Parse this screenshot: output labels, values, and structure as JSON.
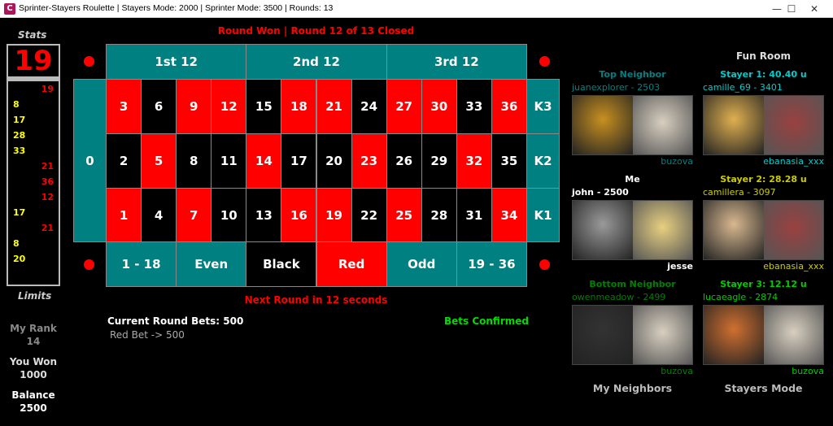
{
  "window": {
    "title": "Sprinter-Stayers Roulette | Stayers Mode: 2000 | Sprinter Mode: 3500 | Rounds: 13",
    "icon_letter": "C",
    "minimize": "—",
    "maximize": "☐",
    "close": "✕"
  },
  "status": {
    "round": "Round Won | Round 12 of 13 Closed",
    "next": "Next Round in 12 seconds",
    "confirmed": "Bets Confirmed"
  },
  "stats": {
    "label": "Stats",
    "last": "19",
    "history": [
      {
        "v": "19",
        "side": "r"
      },
      {
        "v": "8",
        "side": "l"
      },
      {
        "v": "17",
        "side": "l"
      },
      {
        "v": "28",
        "side": "l"
      },
      {
        "v": "33",
        "side": "l"
      },
      {
        "v": "21",
        "side": "r"
      },
      {
        "v": "36",
        "side": "r"
      },
      {
        "v": "12",
        "side": "r"
      },
      {
        "v": "17",
        "side": "l"
      },
      {
        "v": "21",
        "side": "r"
      },
      {
        "v": "8",
        "side": "l"
      },
      {
        "v": "20",
        "side": "l"
      }
    ],
    "limits": "Limits",
    "rank_label": "My Rank",
    "rank": "14",
    "won_label": "You Won",
    "won": "1000",
    "balance_label": "Balance",
    "balance": "2500"
  },
  "board": {
    "zero": "0",
    "dozens": [
      "1st 12",
      "2nd 12",
      "3rd 12"
    ],
    "columns": [
      "K3",
      "K2",
      "K1"
    ],
    "rows": [
      [
        [
          "3",
          "red"
        ],
        [
          "6",
          "blk"
        ],
        [
          "9",
          "red"
        ],
        [
          "12",
          "red"
        ],
        [
          "15",
          "blk"
        ],
        [
          "18",
          "red"
        ],
        [
          "21",
          "red"
        ],
        [
          "24",
          "blk"
        ],
        [
          "27",
          "red"
        ],
        [
          "30",
          "red"
        ],
        [
          "33",
          "blk"
        ],
        [
          "36",
          "red"
        ]
      ],
      [
        [
          "2",
          "blk"
        ],
        [
          "5",
          "red"
        ],
        [
          "8",
          "blk"
        ],
        [
          "11",
          "blk"
        ],
        [
          "14",
          "red"
        ],
        [
          "17",
          "blk"
        ],
        [
          "20",
          "blk"
        ],
        [
          "23",
          "red"
        ],
        [
          "26",
          "blk"
        ],
        [
          "29",
          "blk"
        ],
        [
          "32",
          "red"
        ],
        [
          "35",
          "blk"
        ]
      ],
      [
        [
          "1",
          "red"
        ],
        [
          "4",
          "blk"
        ],
        [
          "7",
          "red"
        ],
        [
          "10",
          "blk"
        ],
        [
          "13",
          "blk"
        ],
        [
          "16",
          "red"
        ],
        [
          "19",
          "red"
        ],
        [
          "22",
          "blk"
        ],
        [
          "25",
          "red"
        ],
        [
          "28",
          "blk"
        ],
        [
          "31",
          "blk"
        ],
        [
          "34",
          "red"
        ]
      ]
    ],
    "outside": [
      [
        "1 - 18",
        "teal"
      ],
      [
        "Even",
        "teal"
      ],
      [
        "Black",
        "blk"
      ],
      [
        "Red",
        "red"
      ],
      [
        "Odd",
        "teal"
      ],
      [
        "19 - 36",
        "teal"
      ]
    ],
    "winning_number": "19",
    "checked_bet": "Red",
    "check_mark": "☑"
  },
  "bets": {
    "title": "Current Round Bets: 500",
    "items": [
      "Red Bet -> 500"
    ]
  },
  "right": {
    "fun_room": "Fun Room",
    "my_neighbors": "My Neighbors",
    "stayers_mode": "Stayers Mode",
    "panels": [
      {
        "heading": "Top Neighbor",
        "player": "juanexplorer  -  2503",
        "partner": "buzova",
        "color": "#008080",
        "c1": "#c89020",
        "c2": "#d8cfc0"
      },
      {
        "heading": "Me",
        "player": "john - 2500",
        "partner": "jesse",
        "color": "#ffffff",
        "c1": "#9a9a9a",
        "c2": "#e8d080"
      },
      {
        "heading": "Bottom Neighbor",
        "player": "owenmeadow  -  2499",
        "partner": "buzova",
        "color": "#008000",
        "c1": "#333333",
        "c2": "#d8cfc0"
      },
      {
        "heading": "Stayer 1: 40.40 u",
        "player": "camille_69  -  3401",
        "partner": "ebanasia_xxx",
        "color": "#00cccc",
        "c1": "#e0b050",
        "c2": "#9a4040"
      },
      {
        "heading": "Stayer 2: 28.28 u",
        "player": "camillera  -  3097",
        "partner": "ebanasia_xxx",
        "color": "#cccc00",
        "c1": "#d8b890",
        "c2": "#9a4040"
      },
      {
        "heading": "Stayer 3: 12.12 u",
        "player": "lucaeagle  -  2874",
        "partner": "buzova",
        "color": "#00cc00",
        "c1": "#d07030",
        "c2": "#d8cfc0"
      }
    ]
  }
}
